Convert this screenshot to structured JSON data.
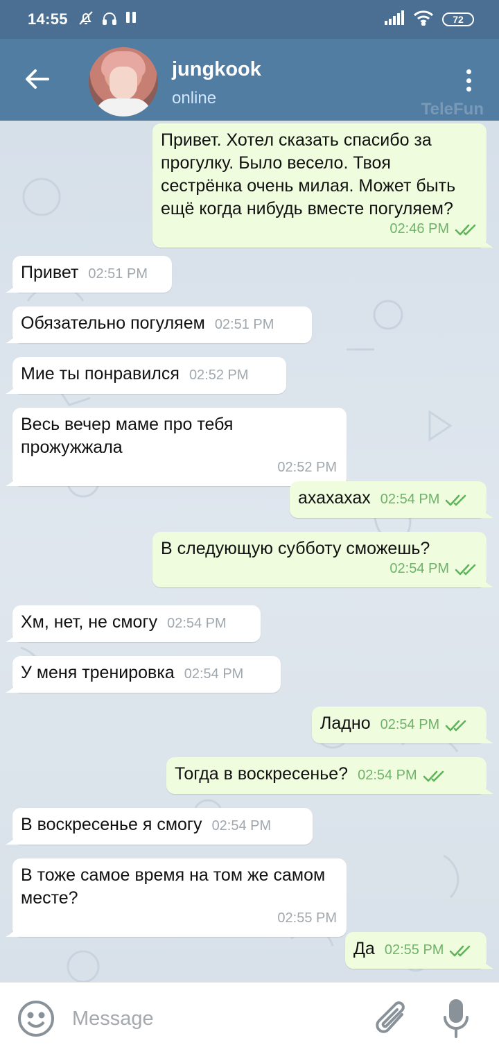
{
  "status_bar": {
    "time": "14:55",
    "battery": "72"
  },
  "header": {
    "contact_name": "jungkook",
    "contact_status": "online",
    "watermark": "TeleFun"
  },
  "messages": [
    {
      "dir": "out",
      "text": "Привет. Хотел сказать спасибо за прогулку. Было весело. Твоя сестрёнка очень милая. Может быть ещё когда нибудь вместе погуляем?",
      "time": "02:46 PM",
      "read": true
    },
    {
      "dir": "in",
      "text": "Привет",
      "time": "02:51 PM"
    },
    {
      "dir": "in",
      "text": "Обязательно погуляем",
      "time": "02:51 PM"
    },
    {
      "dir": "in",
      "text": "Мие ты понравился",
      "time": "02:52 PM"
    },
    {
      "dir": "in",
      "text": "Весь вечер маме про тебя прожужжала",
      "time": "02:52 PM"
    },
    {
      "dir": "out",
      "text": "ахахахах",
      "time": "02:54 PM",
      "read": true
    },
    {
      "dir": "out",
      "text": "В следующую субботу сможешь?",
      "time": "02:54 PM",
      "read": true
    },
    {
      "dir": "in",
      "text": "Хм, нет, не смогу",
      "time": "02:54 PM"
    },
    {
      "dir": "in",
      "text": "У меня тренировка",
      "time": "02:54 PM"
    },
    {
      "dir": "out",
      "text": "Ладно",
      "time": "02:54 PM",
      "read": true
    },
    {
      "dir": "out",
      "text": "Тогда в воскресенье?",
      "time": "02:54 PM",
      "read": true
    },
    {
      "dir": "in",
      "text": "В воскресенье я смогу",
      "time": "02:54 PM"
    },
    {
      "dir": "in",
      "text": "В тоже самое время на том же самом месте?",
      "time": "02:55 PM"
    },
    {
      "dir": "out",
      "text": "Да",
      "time": "02:55 PM",
      "read": true
    }
  ],
  "input": {
    "placeholder": "Message"
  },
  "colors": {
    "header": "#527da3",
    "status_bar": "#4a6f93",
    "incoming_bubble": "#ffffff",
    "outgoing_bubble": "#effdde",
    "read_tick": "#5fb35a"
  },
  "icons": [
    "back-arrow-icon",
    "more-vert-icon",
    "emoji-icon",
    "attach-icon",
    "mic-icon",
    "double-check-icon",
    "mute-bell-icon",
    "headphones-icon",
    "pause-icon",
    "signal-icon",
    "wifi-icon"
  ]
}
